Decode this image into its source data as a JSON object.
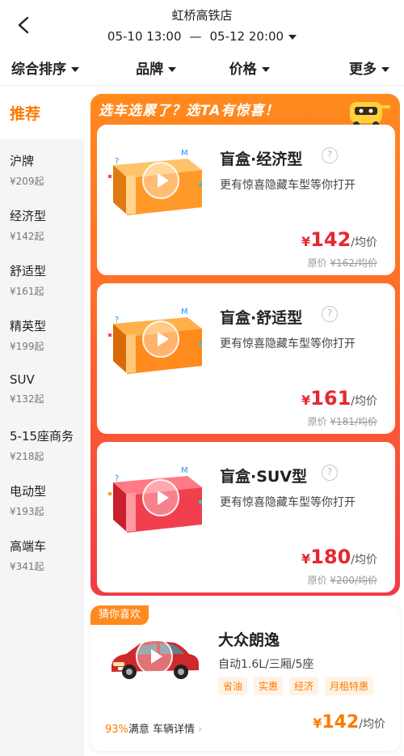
{
  "header": {
    "store": "虹桥高铁店",
    "pickup": "05-10 13:00",
    "separator": "—",
    "return": "05-12 20:00"
  },
  "filters": [
    "综合排序",
    "品牌",
    "价格",
    "更多"
  ],
  "sidebar": {
    "active": "推荐",
    "items": [
      {
        "name": "沪牌",
        "price": "¥209起"
      },
      {
        "name": "经济型",
        "price": "¥142起"
      },
      {
        "name": "舒适型",
        "price": "¥161起"
      },
      {
        "name": "精英型",
        "price": "¥199起"
      },
      {
        "name": "SUV",
        "price": "¥132起"
      },
      {
        "name": "5-15座商务",
        "price": "¥218起"
      },
      {
        "name": "电动型",
        "price": "¥193起"
      },
      {
        "name": "高端车",
        "price": "¥341起"
      }
    ]
  },
  "blind_box": {
    "banner": "选车选累了？选TA有惊喜！",
    "cards": [
      {
        "title": "盲盒·经济型",
        "desc": "更有惊喜隐藏车型等你打开",
        "currency": "¥",
        "price": "142",
        "unit": "/均价",
        "orig_label": "原价",
        "orig_price": "¥162/均价",
        "box_color": "#ff9a2a"
      },
      {
        "title": "盲盒·舒适型",
        "desc": "更有惊喜隐藏车型等你打开",
        "currency": "¥",
        "price": "161",
        "unit": "/均价",
        "orig_label": "原价",
        "orig_price": "¥181/均价",
        "box_color": "#ff8a1e"
      },
      {
        "title": "盲盒·SUV型",
        "desc": "更有惊喜隐藏车型等你打开",
        "currency": "¥",
        "price": "180",
        "unit": "/均价",
        "orig_label": "原价",
        "orig_price": "¥200/均价",
        "box_color": "#f0404e"
      }
    ],
    "help_symbol": "?"
  },
  "recommend": {
    "tag": "猜你喜欢",
    "name": "大众朗逸",
    "spec": "自动1.6L/三厢/5座",
    "tags": [
      "省油",
      "实惠",
      "经济",
      "月租特惠"
    ],
    "satisfaction_pct": "93%",
    "satisfaction_text": "满意 车辆详情",
    "chevron": "›",
    "currency": "¥",
    "price": "142",
    "unit": "/均价",
    "car_color": "#d0282c"
  }
}
